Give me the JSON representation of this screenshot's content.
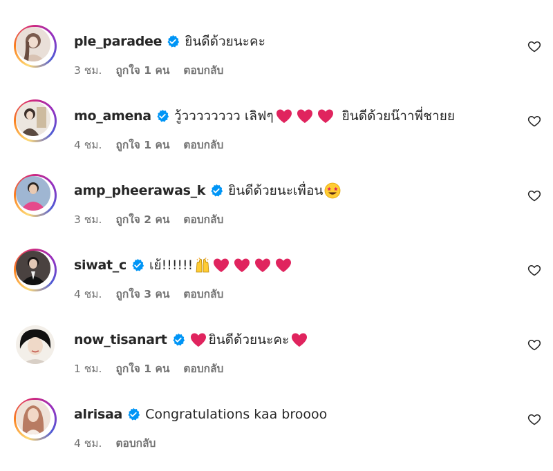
{
  "comments": [
    {
      "username": "ple_paradee",
      "text": "ยินดีด้วยนะคะ",
      "time": "3 ชม.",
      "likes": "ถูกใจ 1 คน",
      "reply": "ตอบกลับ",
      "emoji_after": [],
      "ring": true,
      "avatar_colors": [
        "#c9b9b0",
        "#7a5b4e",
        "#efe3da"
      ]
    },
    {
      "username": "mo_amena",
      "text_before": "วู้วววววววว เลิฟๆ",
      "text_after": "ยินดีด้วยน๊าาพี่ชายย",
      "time": "4 ชม.",
      "likes": "ถูกใจ 1 คน",
      "reply": "ตอบกลับ",
      "hearts": 3,
      "ring": true,
      "avatar_colors": [
        "#ddd6cf",
        "#8a7a6b",
        "#f3eee9"
      ]
    },
    {
      "username": "amp_pheerawas_k",
      "text": "ยินดีด้วยนะเพื่อน",
      "emoji": "star-struck-emoji",
      "time": "3 ชม.",
      "likes": "ถูกใจ 2 คน",
      "reply": "ตอบกลับ",
      "ring": true,
      "avatar_colors": [
        "#8aa5c6",
        "#e54a8b",
        "#e9d3c4"
      ]
    },
    {
      "username": "siwat_c",
      "text": "เย้!!!!!!",
      "emoji": "raised-hands-emoji",
      "hearts": 4,
      "time": "4 ชม.",
      "likes": "ถูกใจ 3 คน",
      "reply": "ตอบกลับ",
      "ring": true,
      "avatar_colors": [
        "#2b2b2b",
        "#d9c4b5",
        "#5a4a42"
      ]
    },
    {
      "username": "now_tisanart",
      "text": "ยินดีด้วยนะคะ",
      "time": "1 ชม.",
      "likes": "ถูกใจ 1 คน",
      "reply": "ตอบกลับ",
      "ring": false,
      "avatar_colors": [
        "#111111",
        "#efd9c8",
        "#c96a5f"
      ]
    },
    {
      "username": "alrisaa",
      "text": "Congratulations kaa broooo",
      "time": "4 ชม.",
      "reply": "ตอบกลับ",
      "ring": true,
      "avatar_colors": [
        "#b87b62",
        "#f2d8c7",
        "#d7b19c"
      ]
    }
  ],
  "colors": {
    "verified": "#0095f6",
    "heart_emoji": "#e0245e",
    "meta_text": "#737373",
    "primary_text": "#262626"
  }
}
